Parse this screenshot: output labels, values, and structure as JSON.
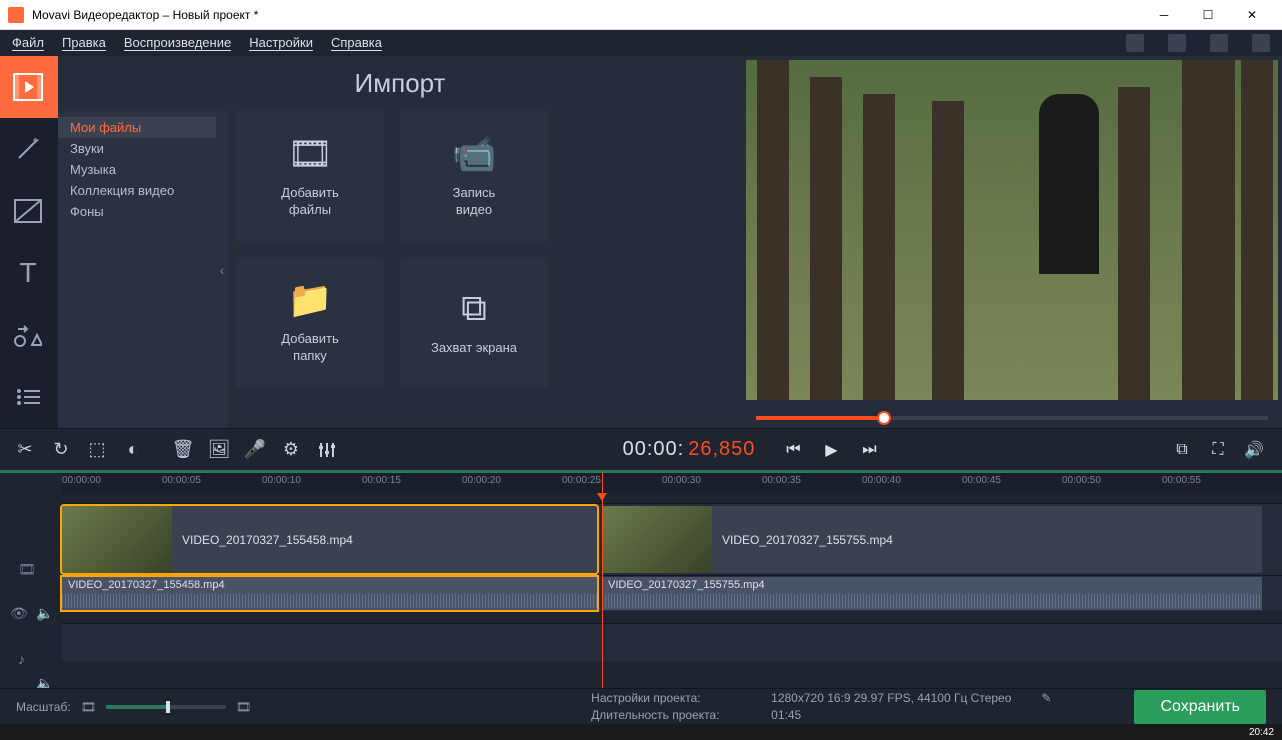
{
  "window": {
    "title": "Movavi Видеоредактор – Новый проект *"
  },
  "menu": {
    "file": "Файл",
    "edit": "Правка",
    "playback": "Воспроизведение",
    "settings": "Настройки",
    "help": "Справка"
  },
  "import": {
    "title": "Импорт",
    "categories": [
      "Мои файлы",
      "Звуки",
      "Музыка",
      "Коллекция видео",
      "Фоны"
    ],
    "tiles": {
      "addfiles": "Добавить\nфайлы",
      "recvideo": "Запись\nвидео",
      "addfolder": "Добавить\nпапку",
      "capture": "Захват экрана"
    }
  },
  "timecode": {
    "white": "00:00:",
    "red": "26,850"
  },
  "ruler": [
    "00:00:00",
    "00:00:05",
    "00:00:10",
    "00:00:15",
    "00:00:20",
    "00:00:25",
    "00:00:30",
    "00:00:35",
    "00:00:40",
    "00:00:45",
    "00:00:50",
    "00:00:55"
  ],
  "clips": {
    "v1": "VIDEO_20170327_155458.mp4",
    "v2": "VIDEO_20170327_155755.mp4",
    "a1": "VIDEO_20170327_155458.mp4",
    "a2": "VIDEO_20170327_155755.mp4"
  },
  "status": {
    "zoom_label": "Масштаб:",
    "project_settings_label": "Настройки проекта:",
    "project_settings_value": "1280x720 16:9 29.97 FPS, 44100 Гц Стерео",
    "duration_label": "Длительность проекта:",
    "duration_value": "01:45",
    "save": "Сохранить"
  },
  "taskbar": {
    "time": "20:42"
  }
}
